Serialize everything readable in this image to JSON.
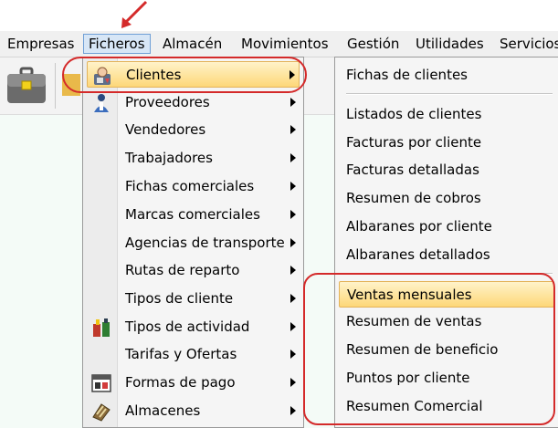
{
  "menubar": {
    "items": [
      "Empresas",
      "Ficheros",
      "Almacén",
      "Movimientos",
      "Gestión",
      "Utilidades",
      "Servicios"
    ],
    "active_index": 1
  },
  "ficheros_menu": {
    "items": [
      {
        "label": "Clientes",
        "icon": "client-icon",
        "submenu": true,
        "highlighted": true
      },
      {
        "label": "Proveedores",
        "icon": "supplier-icon",
        "submenu": true
      },
      {
        "label": "Vendedores",
        "submenu": true
      },
      {
        "label": "Trabajadores",
        "submenu": true
      },
      {
        "label": "Fichas comerciales",
        "submenu": true
      },
      {
        "label": "Marcas comerciales",
        "submenu": true
      },
      {
        "label": "Agencias de transporte",
        "submenu": true
      },
      {
        "label": "Rutas de reparto",
        "submenu": true
      },
      {
        "label": "Tipos de cliente",
        "submenu": true
      },
      {
        "label": "Tipos de actividad",
        "icon": "activity-icon",
        "submenu": true
      },
      {
        "label": "Tarifas y Ofertas",
        "submenu": true
      },
      {
        "label": "Formas de pago",
        "icon": "payment-icon",
        "submenu": true
      },
      {
        "label": "Almacenes",
        "icon": "warehouse-icon",
        "submenu": true
      }
    ]
  },
  "clientes_submenu": {
    "items": [
      {
        "label": "Fichas de clientes"
      },
      {
        "label": "Listados de clientes"
      },
      {
        "label": "Facturas por cliente"
      },
      {
        "label": "Facturas detalladas"
      },
      {
        "label": "Resumen de cobros"
      },
      {
        "label": "Albaranes por cliente"
      },
      {
        "label": "Albaranes detallados"
      },
      {
        "label": "Ventas mensuales",
        "highlighted": true
      },
      {
        "label": "Resumen de ventas"
      },
      {
        "label": "Resumen de beneficio"
      },
      {
        "label": "Puntos por cliente"
      },
      {
        "label": "Resumen Comercial"
      }
    ]
  },
  "colors": {
    "annotation": "#d42a2a",
    "highlight_top": "#fff3c9",
    "highlight_bottom": "#fdd778",
    "menubar_active": "#d7e6f6"
  }
}
